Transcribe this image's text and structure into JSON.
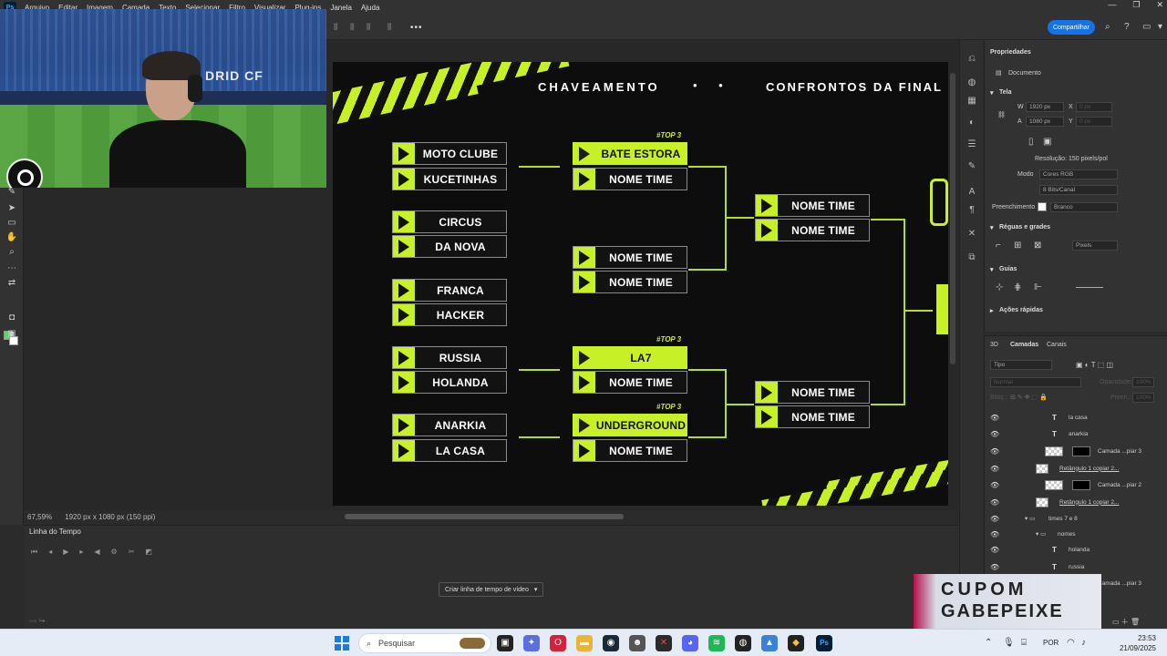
{
  "menu": {
    "items": [
      "Arquivo",
      "Editar",
      "Imagem",
      "Camada",
      "Texto",
      "Selecionar",
      "Filtro",
      "Visualizar",
      "Plug-ins",
      "Janela",
      "Ajuda"
    ],
    "window_controls": [
      "—",
      "❐",
      "✕"
    ]
  },
  "optionsbar": {
    "share_label": "Compartilhar",
    "more_label": "•••"
  },
  "webcam": {
    "banner_text": "DRID CF"
  },
  "design": {
    "header_left": "CHAVEAMENTO",
    "header_dots": "• •",
    "header_right": "CONFRONTOS DA FINAL",
    "top3_label": "#TOP 3",
    "round1": [
      "MOTO CLUBE",
      "KUCETINHAS",
      "CIRCUS",
      "DA NOVA",
      "FRANCA",
      "HACKER",
      "RUSSIA",
      "HOLANDA",
      "ANARKIA",
      "LA CASA"
    ],
    "round2": [
      "BATE ESTORA",
      "NOME TIME",
      "NOME TIME",
      "NOME TIME",
      "LA7",
      "NOME TIME",
      "UNDERGROUND",
      "NOME TIME"
    ],
    "round3": [
      "NOME TIME",
      "NOME TIME",
      "NOME TIME",
      "NOME TIME"
    ]
  },
  "status": {
    "zoom": "67,59%",
    "doc_info": "1920 px x 1080 px (150 ppi)"
  },
  "timeline": {
    "tab_label": "Linha do Tempo",
    "create_button": "Criar linha de tempo de vídeo"
  },
  "properties": {
    "tab_label": "Propriedades",
    "doc_label": "Documento",
    "section_canvas": "Tela",
    "w_label": "W",
    "w_value": "1920 px",
    "h_label": "A",
    "h_value": "1080 px",
    "x_label": "X",
    "y_label": "Y",
    "x_value": "0 px",
    "y_value": "0 px",
    "resolution": "Resolução: 150 pixels/pol",
    "mode_label": "Modo",
    "mode_value": "Cores RGB",
    "depth_value": "8 Bits/Canal",
    "fill_label": "Preenchimento",
    "fill_value": "Branco",
    "section_rulers": "Réguas e grades",
    "units_value": "Pixels",
    "section_guides": "Guias",
    "section_actions": "Ações rápidas"
  },
  "layers": {
    "tabs": [
      "3D",
      "Camadas",
      "Canais"
    ],
    "filter_value": "Tipo",
    "blend_value": "Normal",
    "opacity_label": "Opacidade:",
    "opacity_value": "100%",
    "lock_label": "Bloq.:",
    "fill_label": "Preen.:",
    "fill_value": "100%",
    "rows": [
      {
        "type": "text",
        "name": "la casa"
      },
      {
        "type": "text",
        "name": "anarkia"
      },
      {
        "type": "mask",
        "name": "Camada ...piar 3"
      },
      {
        "type": "shape",
        "name": "Retângulo 1 copiar 2..."
      },
      {
        "type": "mask",
        "name": "Camada ...piar 2"
      },
      {
        "type": "shape",
        "name": "Retângulo 1 copiar 2..."
      },
      {
        "type": "group",
        "name": "times 7 e 8"
      },
      {
        "type": "group",
        "name": "nomes"
      },
      {
        "type": "text",
        "name": "holanda"
      },
      {
        "type": "text",
        "name": "russia"
      },
      {
        "type": "mask",
        "name": "Camada ...piar 3"
      }
    ]
  },
  "coupon": {
    "line1": "CUPOM",
    "line2": "GABEPEIXE"
  },
  "taskbar": {
    "search_placeholder": "Pesquisar",
    "language": "POR",
    "time": "23:53",
    "date": "21/09/2025"
  },
  "colors": {
    "accent_lime": "#c8f026",
    "share_blue": "#1473e6",
    "foreground": "#5bd56a"
  }
}
